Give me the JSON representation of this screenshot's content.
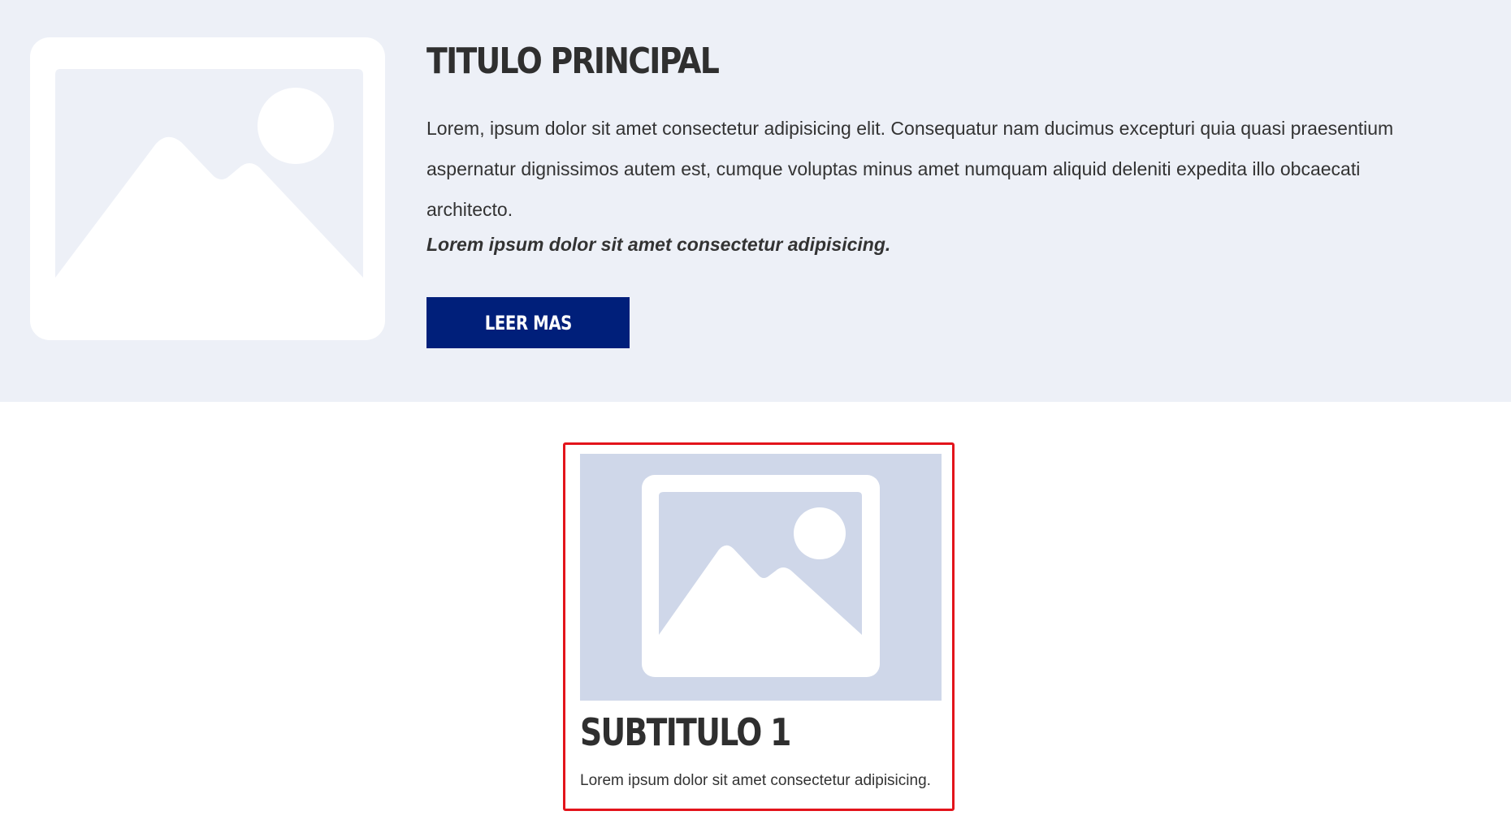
{
  "hero": {
    "image_icon": "image-placeholder-icon",
    "title": "TITULO PRINCIPAL",
    "paragraph": "Lorem, ipsum dolor sit amet consectetur adipisicing elit. Consequatur nam ducimus excepturi quia quasi praesentium aspernatur dignissimos autem est, cumque voluptas minus amet numquam aliquid deleniti expedita illo obcaecati architecto.",
    "emphasis": "Lorem ipsum dolor sit amet consectetur adipisicing.",
    "button_label": "LEER MAS",
    "background_color": "#edf0f7",
    "button_color": "#001f7a"
  },
  "card": {
    "image_icon": "image-placeholder-icon",
    "title": "SUBTITULO 1",
    "text": "Lorem ipsum dolor sit amet consectetur adipisicing.",
    "highlight_border_color": "#e3141b",
    "image_background_color": "#cfd7e9"
  }
}
